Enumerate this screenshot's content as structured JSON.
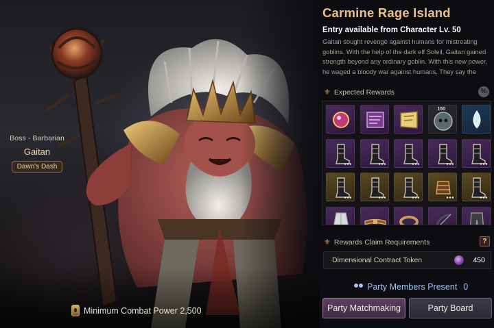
{
  "boss": {
    "class_label": "Boss - Barbarian",
    "name": "Gaitan",
    "tag": "Dawn's Dash"
  },
  "min_combat_power": {
    "label": "Minimum Combat Power 2,500"
  },
  "island": {
    "title": "Carmine Rage Island",
    "entry_requirement": "Entry available from Character Lv. 50",
    "description": "Gaitan sought revenge against humans for mistreating goblins. With the help of the dark elf Soleil, Gaitan gained strength beyond any ordinary goblin. With this new power, he waged a bloody war against humans. They say the blood"
  },
  "rewards": {
    "heading": "Expected Rewards",
    "percent_button": "%",
    "items": [
      {
        "icon": "gem-orb-icon",
        "rarity": "purple"
      },
      {
        "icon": "map-scroll-icon",
        "rarity": "purple"
      },
      {
        "icon": "treasure-map-icon",
        "rarity": "purple"
      },
      {
        "icon": "skull-emblem-icon",
        "rarity": "dark",
        "badge": "150"
      },
      {
        "icon": "water-drop-icon",
        "rarity": "blue"
      },
      {
        "icon": "boots-icon",
        "rarity": "purple",
        "more": true
      },
      {
        "icon": "boots-icon",
        "rarity": "purple",
        "more": true
      },
      {
        "icon": "boots-icon",
        "rarity": "purple",
        "more": true
      },
      {
        "icon": "boots-icon",
        "rarity": "purple",
        "more": true
      },
      {
        "icon": "boots-icon",
        "rarity": "purple",
        "more": true
      },
      {
        "icon": "boots-icon",
        "rarity": "gold",
        "more": true
      },
      {
        "icon": "boots-icon",
        "rarity": "gold",
        "more": true
      },
      {
        "icon": "boots-icon",
        "rarity": "gold",
        "more": true
      },
      {
        "icon": "gauntlet-icon",
        "rarity": "gold",
        "more": true
      },
      {
        "icon": "boots-icon",
        "rarity": "gold",
        "more": true
      },
      {
        "icon": "robe-icon",
        "rarity": "purple"
      },
      {
        "icon": "belt-icon",
        "rarity": "purple"
      },
      {
        "icon": "bracelet-icon",
        "rarity": "purple"
      },
      {
        "icon": "bow-icon",
        "rarity": "purple"
      },
      {
        "icon": "pants-icon",
        "rarity": "purple"
      }
    ]
  },
  "requirements": {
    "heading": "Rewards Claim Requirements",
    "help_button": "?",
    "token_name": "Dimensional Contract Token",
    "token_count": "450"
  },
  "party": {
    "label": "Party Members Present",
    "count": "0"
  },
  "buttons": {
    "matchmaking": "Party Matchmaking",
    "board": "Party Board"
  }
}
